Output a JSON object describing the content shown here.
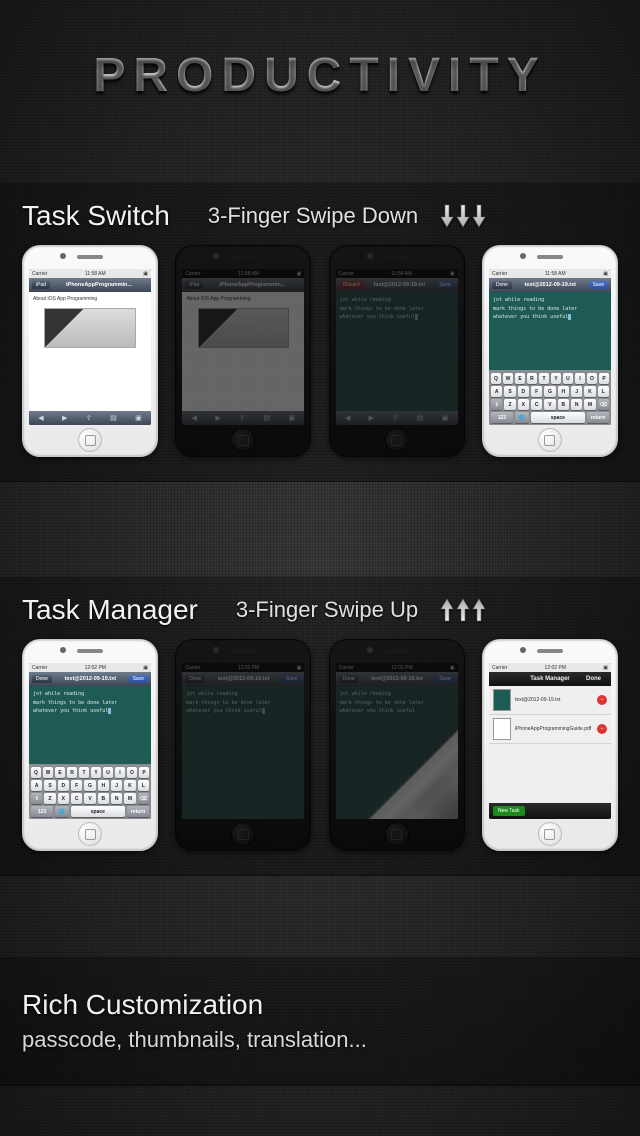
{
  "title": "Productivity",
  "sections": {
    "switch": {
      "heading": "Task Switch",
      "hint": "3-Finger Swipe Down",
      "arrow_dir": "down"
    },
    "manager": {
      "heading": "Task Manager",
      "hint": "3-Finger Swipe Up",
      "arrow_dir": "up"
    },
    "footer": {
      "heading": "Rich Customization",
      "subheading": "passcode, thumbnails, translation..."
    }
  },
  "status": {
    "carrier": "Carrier",
    "time": "11:58 AM",
    "time2": "12:02 PM"
  },
  "safari": {
    "back": "iPad",
    "title": "iPhoneAppProgrammin...",
    "body_heading": "About iOS App Programming"
  },
  "editor": {
    "discard": "Discard",
    "filename": "text@2012-09-19.txt",
    "save": "Save",
    "done": "Done",
    "lines": [
      "jot while reading",
      "mark things to be done later",
      "whatever you think useful"
    ]
  },
  "keyboard": {
    "r1": [
      "Q",
      "W",
      "E",
      "R",
      "T",
      "Y",
      "U",
      "I",
      "O",
      "P"
    ],
    "r2": [
      "A",
      "S",
      "D",
      "F",
      "G",
      "H",
      "J",
      "K",
      "L"
    ],
    "r3_shift": "⇧",
    "r3": [
      "Z",
      "X",
      "C",
      "V",
      "B",
      "N",
      "M"
    ],
    "r3_del": "⌫",
    "r4": {
      "num": "123",
      "globe": "🌐",
      "space": "space",
      "ret": "return"
    }
  },
  "curl": {
    "new_task": "New Task"
  },
  "task_manager": {
    "title": "Task Manager",
    "done": "Done",
    "items": [
      {
        "label": "text@2012-09-19.txt"
      },
      {
        "label": "iPhoneAppProgrammingGuide.pdf"
      }
    ],
    "new_task": "New Task"
  }
}
